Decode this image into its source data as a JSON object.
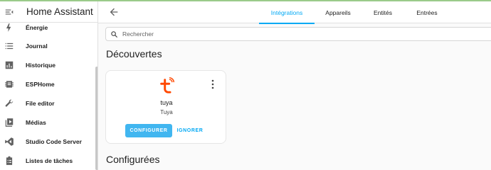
{
  "app": {
    "title": "Home Assistant"
  },
  "sidebar": {
    "items": [
      {
        "label": "Énergie",
        "icon": "lightning-bolt-icon"
      },
      {
        "label": "Journal",
        "icon": "list-icon"
      },
      {
        "label": "Historique",
        "icon": "bar-chart-icon"
      },
      {
        "label": "ESPHome",
        "icon": "esphome-chip-icon"
      },
      {
        "label": "File editor",
        "icon": "wrench-icon"
      },
      {
        "label": "Médias",
        "icon": "media-play-icon"
      },
      {
        "label": "Studio Code Server",
        "icon": "vscode-icon"
      },
      {
        "label": "Listes de tâches",
        "icon": "clipboard-list-icon"
      }
    ]
  },
  "header": {
    "tabs": [
      {
        "label": "Intégrations",
        "active": true
      },
      {
        "label": "Appareils",
        "active": false
      },
      {
        "label": "Entités",
        "active": false
      },
      {
        "label": "Entrées",
        "active": false
      }
    ]
  },
  "search": {
    "placeholder": "Rechercher"
  },
  "discovered": {
    "title": "Découvertes",
    "card": {
      "name": "tuya",
      "subtitle": "Tuya",
      "configure_label": "CONFIGURER",
      "ignore_label": "IGNORER",
      "brand_color": "#ff4800"
    }
  },
  "configured": {
    "title": "Configurées"
  },
  "colors": {
    "accent": "#03a9f4",
    "button": "#41b6f0"
  }
}
